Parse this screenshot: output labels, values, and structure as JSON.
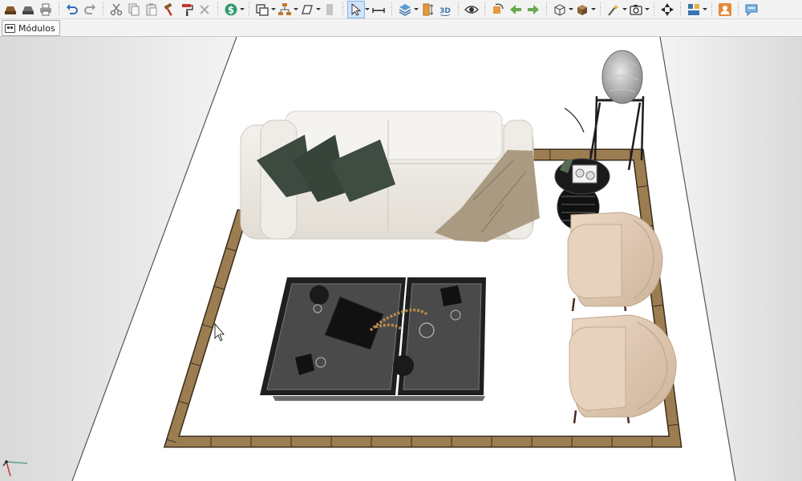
{
  "toolbar": {
    "items": [
      {
        "icon": "open-project-icon"
      },
      {
        "icon": "save-project-icon"
      },
      {
        "icon": "print-icon"
      },
      {
        "icon": "undo-icon"
      },
      {
        "icon": "redo-icon"
      },
      {
        "icon": "cut-icon"
      },
      {
        "icon": "copy-icon"
      },
      {
        "icon": "paste-icon"
      },
      {
        "icon": "hammer-icon"
      },
      {
        "icon": "paint-roller-icon"
      },
      {
        "icon": "delete-icon"
      },
      {
        "icon": "budget-icon"
      },
      {
        "icon": "rooms-icon"
      },
      {
        "icon": "layers-tree-icon"
      },
      {
        "icon": "shape-icon"
      },
      {
        "icon": "select-arrow-icon"
      },
      {
        "icon": "measure-icon"
      },
      {
        "icon": "stack-icon"
      },
      {
        "icon": "elevation-icon"
      },
      {
        "icon": "3d-view-icon"
      },
      {
        "icon": "eye-icon"
      },
      {
        "icon": "rotate-object-icon"
      },
      {
        "icon": "move-left-icon"
      },
      {
        "icon": "move-right-icon"
      },
      {
        "icon": "cube-outline-icon"
      },
      {
        "icon": "box-icon"
      },
      {
        "icon": "magic-wand-icon"
      },
      {
        "icon": "camera-icon"
      },
      {
        "icon": "navigate-icon"
      },
      {
        "icon": "layout-icon"
      },
      {
        "icon": "user-icon"
      },
      {
        "icon": "chat-icon"
      }
    ]
  },
  "module_bar": {
    "button_label": "Módulos",
    "icon": "modules-icon"
  },
  "scene": {
    "colors": {
      "floor": "#ffffff",
      "wall_left": "#e6e6e6",
      "wall_right": "#e9e9e9",
      "rug_border": "#9c7d52",
      "sofa": "#ebe8e2",
      "cushions": "#3c4a40",
      "throw": "#a59479",
      "armchair": "#e3ccb7",
      "table_glass": "#4a4a4a"
    }
  }
}
